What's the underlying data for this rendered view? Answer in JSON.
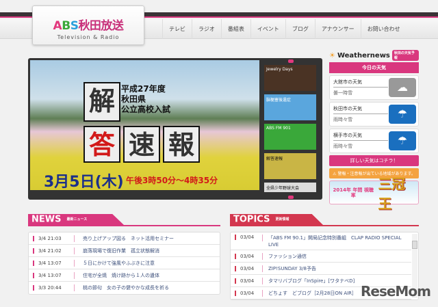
{
  "header": {
    "logo_main_a": "A",
    "logo_main_b": "B",
    "logo_main_s": "S",
    "logo_main_jp": "秋田放送",
    "logo_sub": "Television & Radio",
    "nav": [
      "テレビ",
      "ラジオ",
      "番組表",
      "イベント",
      "ブログ",
      "アナウンサー",
      "お問い合わせ"
    ]
  },
  "banner": {
    "title_lines": [
      "平成27年度",
      "秋田県",
      "公立高校入試"
    ],
    "big_chars": [
      "解",
      "答",
      "速",
      "報"
    ],
    "date": "3月5日(木)",
    "time": "午後3時50分～4時35分",
    "thumbs": [
      "Jewelry Days",
      "脳梗塞後遺症",
      "ABS FM 901",
      "解答速報",
      "全県少年野球大会"
    ]
  },
  "weather": {
    "brand": "Weathernews",
    "badge": "秋田の天気予報",
    "today": "今日の天気",
    "cards": [
      {
        "city": "大館市の天気",
        "cond": "曇一時雪",
        "icon": "cloud-icon",
        "color": "#999999"
      },
      {
        "city": "秋田市の天気",
        "cond": "雨時々雪",
        "icon": "umbrella-icon",
        "color": "#1a6fbf"
      },
      {
        "city": "横手市の天気",
        "cond": "雨時々雪",
        "icon": "umbrella-icon",
        "color": "#1a6fbf"
      }
    ],
    "detail": "詳しい天気はコチラ！",
    "alert": "警報・注意報が出ている地域があります。",
    "promo_left": "2014年 年間 視聴率",
    "promo_right": "三冠王"
  },
  "news": {
    "title": "NEWS",
    "subtitle": "最新ニュース",
    "items": [
      {
        "time": "3/4 21:03",
        "text": "売り上げアップ図る　ネット活用セミナー"
      },
      {
        "time": "3/4 21:02",
        "text": "崩落現場で復旧作業　孤立状態解消"
      },
      {
        "time": "3/4 13:07",
        "text": "５日にかけて強風やふぶきに注意"
      },
      {
        "time": "3/4 13:07",
        "text": "住宅が全焼　焼け跡から１人の遺体"
      },
      {
        "time": "3/3 20:44",
        "text": "桃の節句　女の子の健やかな成長を祈る"
      }
    ]
  },
  "topics": {
    "title": "TOPICS",
    "subtitle": "更新情報",
    "items": [
      {
        "time": "03/04",
        "text": "「ABS FM 90.1」開局記念特別番組　CLAP RADIO SPECIAL LIVE"
      },
      {
        "time": "03/04",
        "text": "ファッション通信"
      },
      {
        "time": "03/04",
        "text": "ZIP!SUNDAY 3/8予告"
      },
      {
        "time": "03/04",
        "text": "タマリバブログ「InSpire」[ワタナベD]"
      },
      {
        "time": "03/04",
        "text": "どちょす　どブログ［2月28日ON AIR］"
      }
    ]
  },
  "watermark": "ReseMom"
}
